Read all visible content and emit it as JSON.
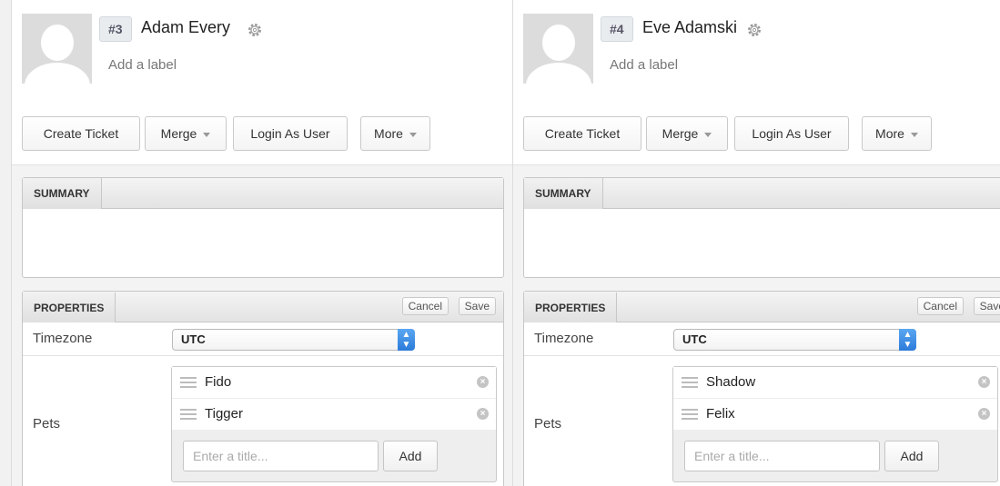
{
  "users": [
    {
      "id_badge": "#3",
      "name": "Adam Every",
      "add_label": "Add a label",
      "buttons": {
        "create_ticket": "Create Ticket",
        "merge": "Merge",
        "login_as_user": "Login As User",
        "more": "More"
      },
      "summary": {
        "title": "SUMMARY"
      },
      "properties": {
        "title": "PROPERTIES",
        "cancel": "Cancel",
        "save": "Save",
        "timezone_label": "Timezone",
        "timezone_value": "UTC",
        "pets_label": "Pets",
        "pets": [
          "Fido",
          "Tigger"
        ],
        "new_pet_placeholder": "Enter a title...",
        "add": "Add"
      }
    },
    {
      "id_badge": "#4",
      "name": "Eve Adamski",
      "add_label": "Add a label",
      "buttons": {
        "create_ticket": "Create Ticket",
        "merge": "Merge",
        "login_as_user": "Login As User",
        "more": "More"
      },
      "summary": {
        "title": "SUMMARY"
      },
      "properties": {
        "title": "PROPERTIES",
        "cancel": "Cancel",
        "save": "Save",
        "timezone_label": "Timezone",
        "timezone_value": "UTC",
        "pets_label": "Pets",
        "pets": [
          "Shadow",
          "Felix"
        ],
        "new_pet_placeholder": "Enter a title...",
        "add": "Add"
      }
    }
  ],
  "icons": {
    "gear": "gear-icon",
    "drag": "drag-handle-icon",
    "remove": "remove-icon",
    "select_arrows": "select-arrows-icon",
    "caret": "caret-down-icon"
  }
}
